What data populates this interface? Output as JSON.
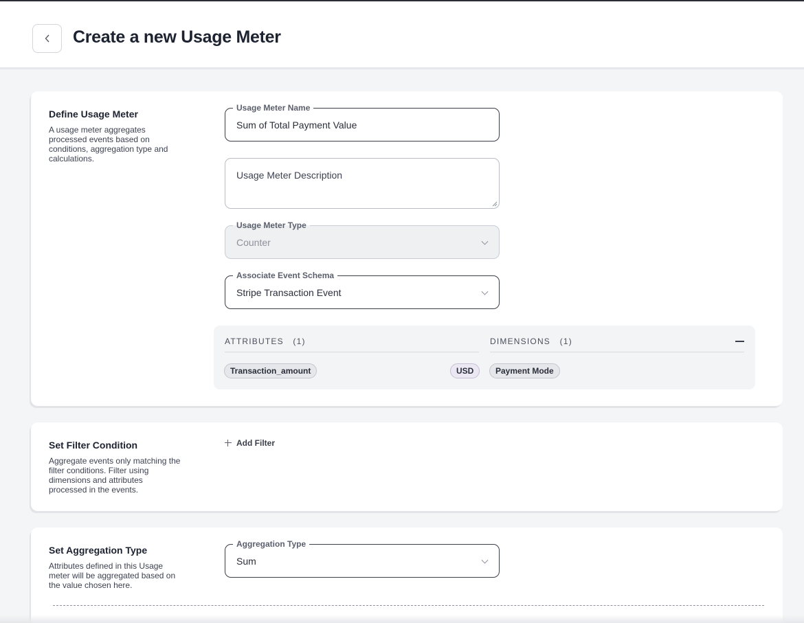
{
  "header": {
    "title": "Create a new Usage Meter",
    "back_icon": "chevron-left-icon"
  },
  "define": {
    "title": "Define Usage Meter",
    "description": "A usage meter aggregates processed events based on conditions, aggregation type and calculations.",
    "name_field": {
      "label": "Usage Meter Name",
      "value": "Sum of Total Payment Value"
    },
    "description_field": {
      "placeholder": "Usage Meter Description"
    },
    "type_field": {
      "label": "Usage Meter Type",
      "value": "Counter"
    },
    "schema_field": {
      "label": "Associate Event Schema",
      "value": "Stripe Transaction Event"
    },
    "attributes": {
      "header": "ATTRIBUTES",
      "count": "(1)",
      "items": [
        {
          "name": "Transaction_amount",
          "unit": "USD"
        }
      ]
    },
    "dimensions": {
      "header": "DIMENSIONS",
      "count": "(1)",
      "items": [
        {
          "name": "Payment Mode"
        }
      ]
    }
  },
  "filter": {
    "title": "Set Filter Condition",
    "description": "Aggregate events only matching the filter conditions. Filter using dimensions and attributes processed in the events.",
    "add_label": "Add Filter"
  },
  "aggregation": {
    "title": "Set Aggregation Type",
    "description": "Attributes defined in this Usage meter will be aggregated based on the value chosen here.",
    "type_field": {
      "label": "Aggregation Type",
      "value": "Sum"
    }
  }
}
